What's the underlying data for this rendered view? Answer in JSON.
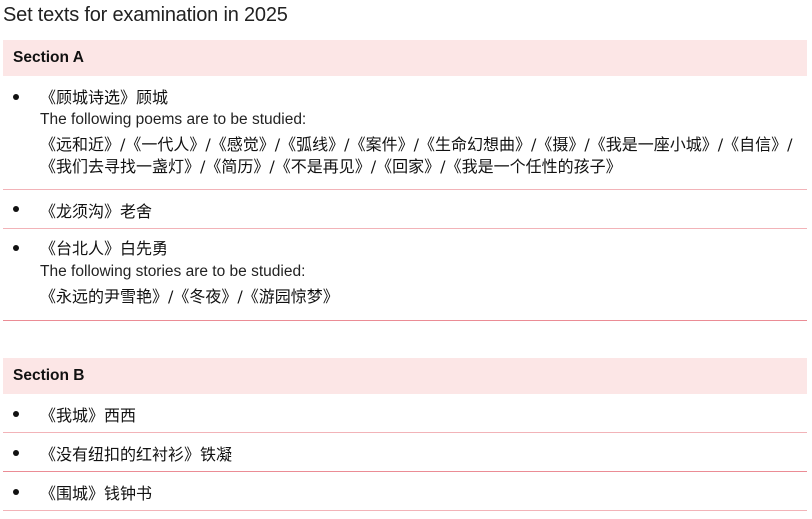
{
  "page": {
    "title": "Set texts for examination in 2025"
  },
  "colors": {
    "section_header_bg": "#fce6e6",
    "separator": "#eb8c95"
  },
  "sections": [
    {
      "header": "Section A",
      "items": [
        {
          "title": "《顾城诗选》顾城",
          "note": "The following poems are to be studied:",
          "works_line1": "《远和近》/《一代人》/《感觉》/《弧线》/《案件》/《生命幻想曲》/《摄》/《我是一座小城》/《自信》/",
          "works_line2": "《我们去寻找一盏灯》/《简历》/《不是再见》/《回家》/《我是一个任性的孩子》"
        },
        {
          "title": "《龙须沟》老舍"
        },
        {
          "title": "《台北人》白先勇",
          "note": "The following stories are to be studied:",
          "works_line1": "《永远的尹雪艳》/《冬夜》/《游园惊梦》"
        }
      ]
    },
    {
      "header": "Section B",
      "items": [
        {
          "title": "《我城》西西"
        },
        {
          "title": "《没有纽扣的红衬衫》铁凝"
        },
        {
          "title": "《围城》钱钟书"
        }
      ]
    }
  ]
}
